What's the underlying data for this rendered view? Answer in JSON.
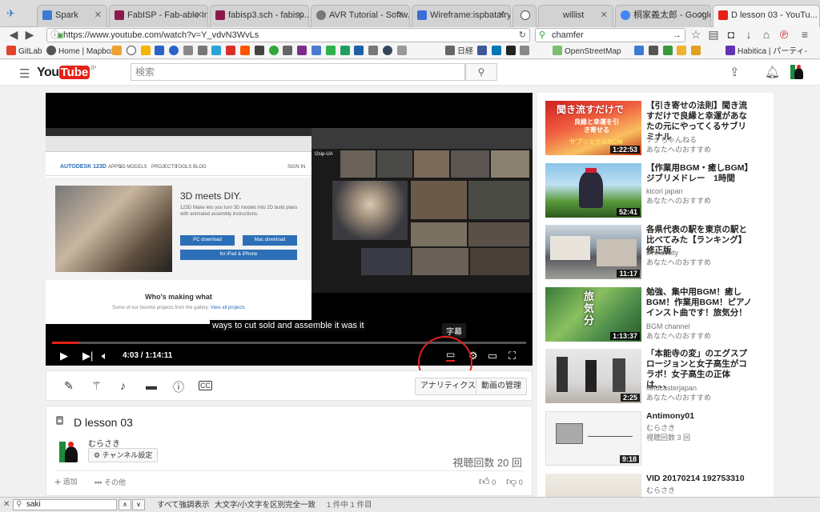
{
  "tabs": [
    {
      "title": "Spark",
      "color": "#3a7bd5"
    },
    {
      "title": "FabISP - Fab-able In...",
      "color": "#8b1a4a"
    },
    {
      "title": "fabisp3.sch - fabisp...",
      "color": "#8b1a4a"
    },
    {
      "title": "AVR Tutorial - Softw...",
      "color": "#777777"
    },
    {
      "title": "Wireframe:ispbatafry...",
      "color": "#3a6fd8"
    },
    {
      "title": "",
      "color": "#555555"
    },
    {
      "title": "willist",
      "color": "#cccccc"
    },
    {
      "title": "桐家義太郎 - Google ...",
      "color": "#4285f4"
    },
    {
      "title": "D lesson 03 - YouTu...",
      "color": "#e62117"
    }
  ],
  "nav": {
    "url": "https://www.youtube.com/watch?v=Y_vdvN3WvLs",
    "search_value": "chamfer"
  },
  "bookmarks": {
    "gitlab": "GitLab",
    "home": "Home | Mapbox",
    "nikkei": "日経",
    "osm": "OpenStreetMap",
    "habitica": "Habitica | パーティ-"
  },
  "youtube": {
    "logo_text": "You",
    "logo_tube": "Tube",
    "region": "JP",
    "search_placeholder": "検索"
  },
  "screen": {
    "header_text": "AUTODESK 123D",
    "menu": [
      "APPS",
      "3D MODELS",
      "PROJECTS",
      "TOOLS",
      "BLOG"
    ],
    "signin": "SIGN IN",
    "hero_title": "3D meets DIY.",
    "hero_text": "123D Make lets you turn 3D models into 2D build plans with animated assembly instructions.",
    "btn_pc": "PC download",
    "btn_mac": "Mac download",
    "btn_ipad": "for iPad & iPhone",
    "whos_making": "Who's making what",
    "whos_sub": "Some of our favorite projects from the gallery.",
    "view_all": "View all projects",
    "conf_label": "l2sip-UA"
  },
  "video": {
    "caption": "ways to cut sold and assemble it was it",
    "time": "4:03 / 1:14:11",
    "progress": 0.055,
    "tooltip": "字幕"
  },
  "actions": {
    "analytics": "アナリティクス",
    "manage": "動画の管理"
  },
  "info": {
    "title": "D lesson 03",
    "channel": "むらさき",
    "channel_settings": "チャンネル設定",
    "views": "視聴回数 20 回",
    "add": "追加",
    "more": "その他",
    "likes": "0",
    "dislikes": "0"
  },
  "recommendations": [
    {
      "title": "【引き寄せの法則】聞き流すだけで良縁と幸運があなたの元にやってくるサブリミナル",
      "channel": "ナグちゃんねる",
      "reason": "あなたへのおすすめ",
      "duration": "1:22:53"
    },
    {
      "title": "【作業用BGM・癒しBGM】ジブリメドレー　1時間",
      "channel": "kicori japan",
      "reason": "あなたへのおすすめ",
      "duration": "52:41"
    },
    {
      "title": "各県代表の駅を東京の駅と比べてみた【ランキング】　修正版",
      "channel": "s relativity",
      "reason": "あなたへのおすすめ",
      "duration": "11:17"
    },
    {
      "title": "勉強、集中用BGM！癒しBGM！作業用BGM！ピアノインスト曲です！旅気分！",
      "channel": "BGM channel",
      "reason": "あなたへのおすすめ",
      "duration": "1:13:37"
    },
    {
      "title": "「本能寺の変」のエグスプロージョンと女子高生がコラボ！女子高生の正体は、、、",
      "channel": "fieldcasterjapan",
      "reason": "あなたへのおすすめ",
      "duration": "2:25"
    },
    {
      "title": "Antimony01",
      "channel": "むらさき",
      "reason": "視聴回数 3 回",
      "duration": "9:18"
    },
    {
      "title": "VID 20170214 192753310",
      "channel": "むらさき",
      "reason": "",
      "duration": ""
    }
  ],
  "thumb_text": {
    "t1": "聞き流すだけで",
    "t1b": "良縁と幸運を引き寄せる",
    "t1c": "サブリミナルBGM",
    "t4": "旅気分"
  },
  "findbar": {
    "value": "saki",
    "highlight_all": "すべて強調表示",
    "match_case": "大文字/小文字を区別",
    "whole_words": "完全一致",
    "result": "1 件中 1 件目"
  }
}
